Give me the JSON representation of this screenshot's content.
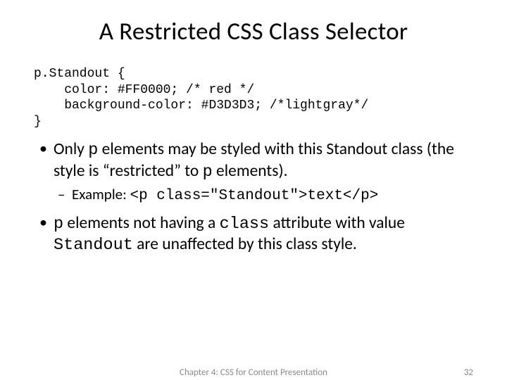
{
  "title": "A Restricted CSS Class Selector",
  "code": {
    "l1": "p.Standout {",
    "l2": "    color: #FF0000; /* red */",
    "l3": "    background-color: #D3D3D3; /*lightgray*/",
    "l4": "}"
  },
  "bullets": {
    "b1": {
      "pre": "Only ",
      "code1": "p",
      "mid": " elements may be styled with this Standout class (the style is “restricted” to ",
      "code2": "p",
      "post": " elements)."
    },
    "b1_sub": {
      "pre": "Example: ",
      "code": "<p class=\"Standout\">text</p>"
    },
    "b2": {
      "code1": "p",
      "t1": " elements not having a ",
      "code2": "class",
      "t2": " attribute with value ",
      "code3": "Standout",
      "t3": " are unaffected by this class style."
    }
  },
  "footer": {
    "center": "Chapter 4: CSS for Content Presentation",
    "page": "32"
  }
}
